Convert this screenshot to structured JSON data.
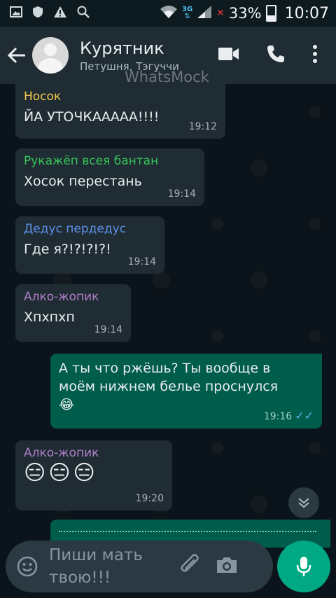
{
  "status_bar": {
    "network_label": "3G",
    "battery": "33%",
    "time": "10:07",
    "icons": [
      "image-icon",
      "shield-icon",
      "warning-icon",
      "search-icon",
      "wifi-icon",
      "signal-icon",
      "battery-icon"
    ]
  },
  "header": {
    "title": "Курятник",
    "subtitle": "Петушня, Тэгуччи",
    "watermark": "WhatsMock"
  },
  "messages": [
    {
      "sender": "Носок",
      "sender_color": "#f4c84a",
      "text": "ЙА УТОЧКААААА!!!!",
      "time": "19:12"
    },
    {
      "sender": "Рукажёп всея бантан",
      "sender_color": "#35c45a",
      "text": "Хосок перестань",
      "time": "19:14"
    },
    {
      "sender": "Дедус пердедус",
      "sender_color": "#5b8fe6",
      "text": "Где я?!?!?!?!",
      "time": "19:14"
    },
    {
      "sender": "Алко-жопик",
      "sender_color": "#b07fc9",
      "text": "Хпхпхп",
      "time": "19:14"
    },
    {
      "sender": "",
      "text": "А ты что ржёшь? Ты вообще в моём нижнем белье проснулся😂",
      "time": "19:16",
      "outgoing": true,
      "read": true
    },
    {
      "sender": "Алко-жопик",
      "sender_color": "#b07fc9",
      "text": "😑😑😑",
      "time": "19:20"
    }
  ],
  "composer": {
    "placeholder": "Пиши мать твою!!!"
  },
  "colors": {
    "header_bg": "#1f2c33",
    "incoming_bubble": "#202c33",
    "outgoing_bubble": "#005c4b",
    "accent": "#00a884",
    "read_ticks": "#53bdeb"
  }
}
